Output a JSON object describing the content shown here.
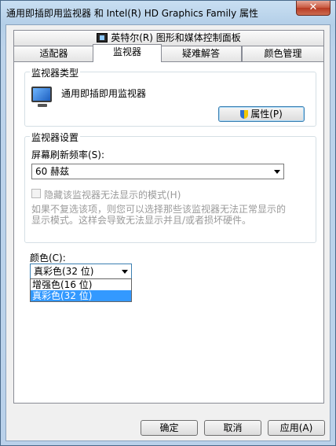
{
  "window": {
    "title": "通用即插即用监视器 和 Intel(R) HD Graphics Family 属性",
    "close_glyph": "✕"
  },
  "tabs": {
    "top_row": [
      "英特尔(R) 图形和媒体控制面板"
    ],
    "bottom_row": [
      "适配器",
      "监视器",
      "疑难解答",
      "颜色管理"
    ],
    "active": "监视器"
  },
  "monitor_type": {
    "group_label": "监视器类型",
    "monitor_name": "通用即插即用监视器",
    "properties_button": "属性(P)",
    "icon": "monitor-icon"
  },
  "monitor_settings": {
    "group_label": "监视器设置",
    "refresh_label": "屏幕刷新频率(S):",
    "refresh_value": "60 赫兹",
    "hide_modes_label": "隐藏该监视器无法显示的模式(H)",
    "hide_modes_checked": false,
    "hint_line1": "如果不复选该项，则您可以选择那些该监视器无法正常显示的",
    "hint_line2": "显示模式。这样会导致无法显示并且/或者损坏硬件。"
  },
  "colors": {
    "label": "颜色(C):",
    "selected": "真彩色(32 位)",
    "options": [
      "增强色(16 位)",
      "真彩色(32 位)"
    ]
  },
  "footer": {
    "ok": "确定",
    "cancel": "取消",
    "apply": "应用(A)"
  }
}
